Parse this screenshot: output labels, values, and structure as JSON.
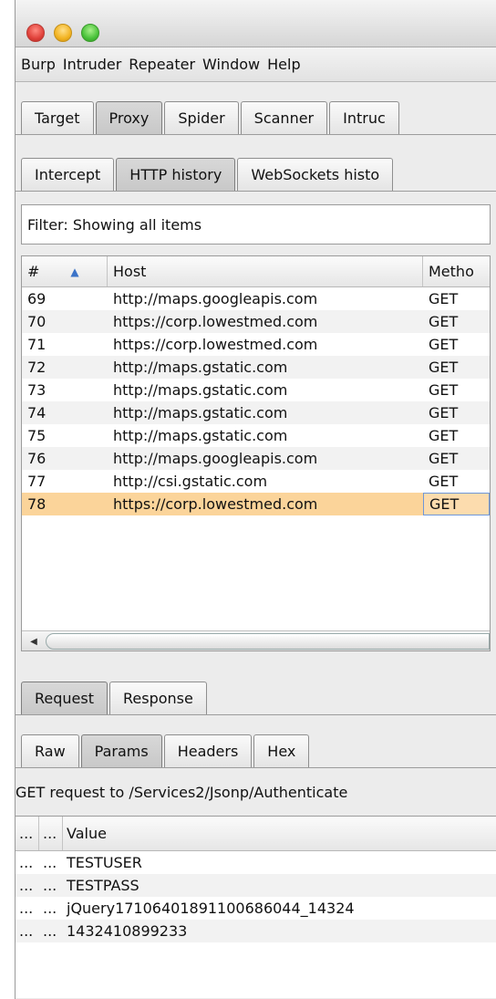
{
  "menu": [
    "Burp",
    "Intruder",
    "Repeater",
    "Window",
    "Help"
  ],
  "main_tabs": [
    "Target",
    "Proxy",
    "Spider",
    "Scanner",
    "Intruc"
  ],
  "proxy_tabs": [
    "Intercept",
    "HTTP history",
    "WebSockets histo"
  ],
  "filter": {
    "label": "Filter: Showing all items"
  },
  "history": {
    "columns": {
      "num": "#",
      "sort_arrow": "▲",
      "host": "Host",
      "method": "Metho"
    },
    "rows": [
      {
        "num": "69",
        "host": "http://maps.googleapis.com",
        "method": "GET"
      },
      {
        "num": "70",
        "host": "https://corp.lowestmed.com",
        "method": "GET"
      },
      {
        "num": "71",
        "host": "https://corp.lowestmed.com",
        "method": "GET"
      },
      {
        "num": "72",
        "host": "http://maps.gstatic.com",
        "method": "GET"
      },
      {
        "num": "73",
        "host": "http://maps.gstatic.com",
        "method": "GET"
      },
      {
        "num": "74",
        "host": "http://maps.gstatic.com",
        "method": "GET"
      },
      {
        "num": "75",
        "host": "http://maps.gstatic.com",
        "method": "GET"
      },
      {
        "num": "76",
        "host": "http://maps.googleapis.com",
        "method": "GET"
      },
      {
        "num": "77",
        "host": "http://csi.gstatic.com",
        "method": "GET"
      },
      {
        "num": "78",
        "host": "https://corp.lowestmed.com",
        "method": "GET"
      }
    ],
    "scroll_left_glyph": "◀"
  },
  "message_tabs": [
    "Request",
    "Response"
  ],
  "view_tabs": [
    "Raw",
    "Params",
    "Headers",
    "Hex"
  ],
  "request_info": "GET request to /Services2/Jsonp/Authenticate",
  "params": {
    "columns": {
      "c1": "...",
      "c2": "...",
      "value": "Value"
    },
    "rows": [
      {
        "c1": "...",
        "c2": "...",
        "value": "TESTUSER"
      },
      {
        "c1": "...",
        "c2": "...",
        "value": "TESTPASS"
      },
      {
        "c1": "...",
        "c2": "...",
        "value": "jQuery17106401891100686044_14324"
      },
      {
        "c1": "...",
        "c2": "...",
        "value": "1432410899233"
      }
    ]
  },
  "colors": {
    "selected_row": "#fbd49a",
    "sort_arrow": "#3b73c8"
  }
}
